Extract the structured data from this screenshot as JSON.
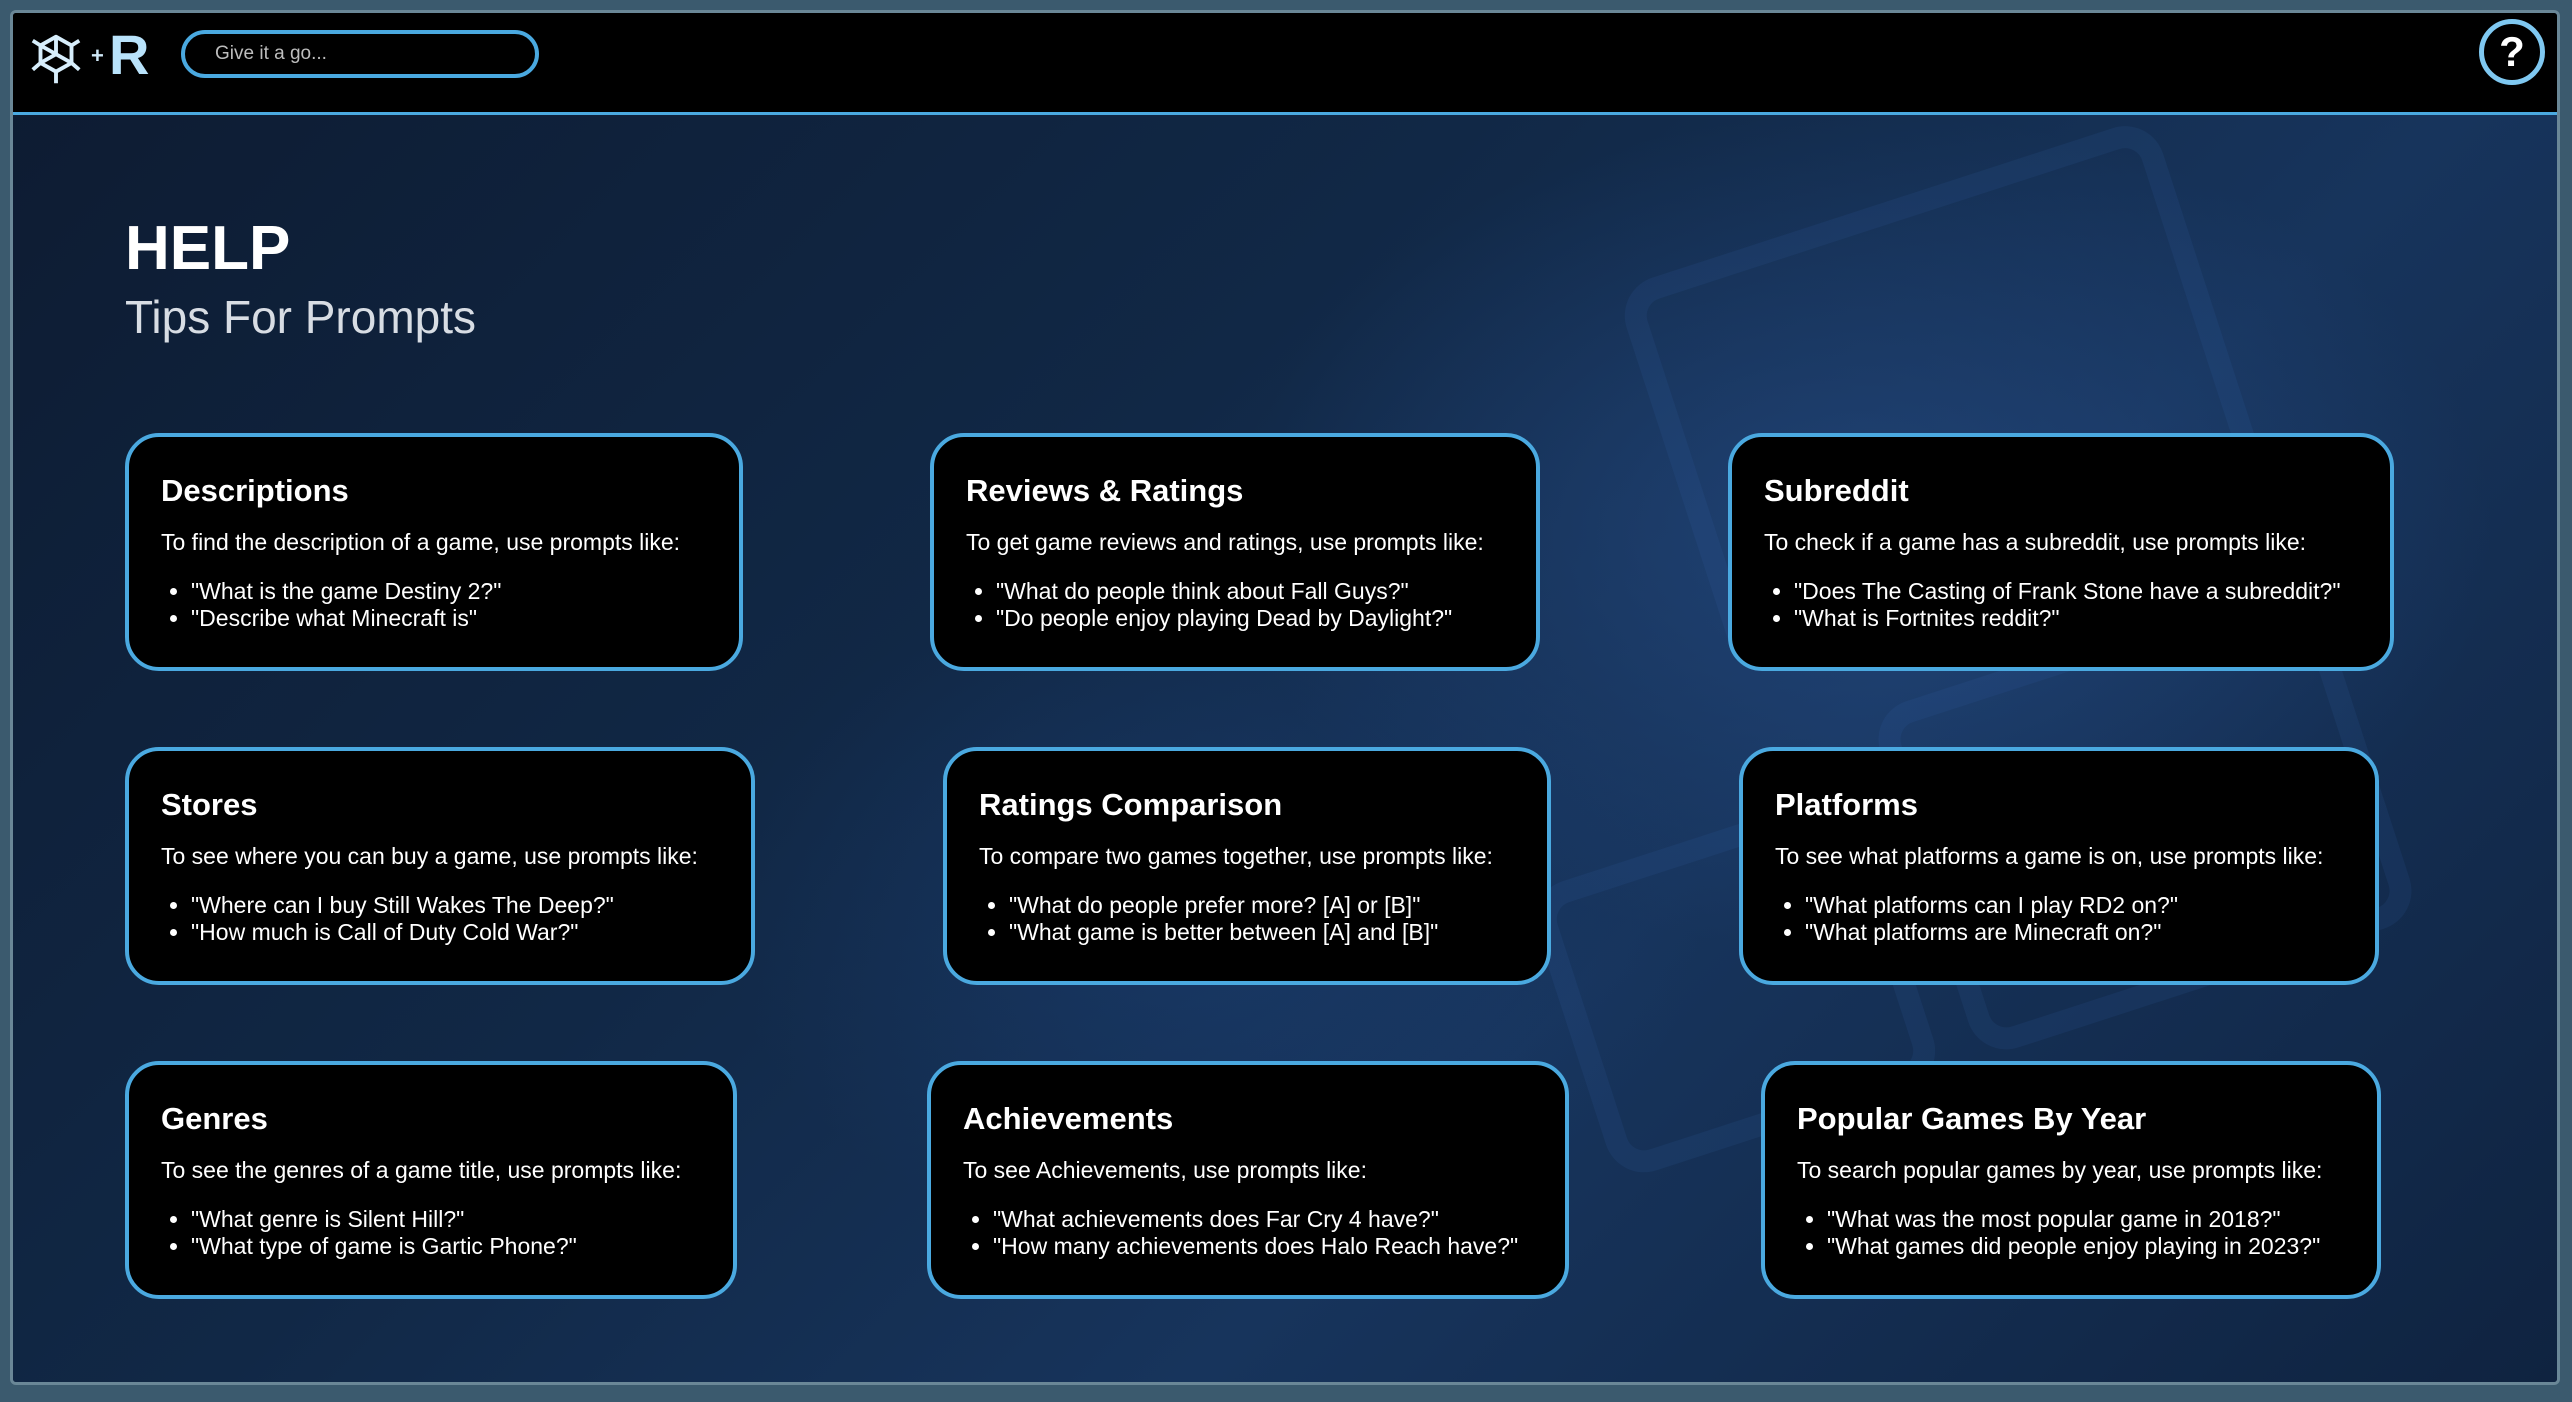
{
  "search": {
    "placeholder": "Give it a go..."
  },
  "header": {
    "help_glyph": "?",
    "plus_glyph": "+",
    "logo_letter": "R"
  },
  "icons": {
    "brand_logo": "openai-logo-icon",
    "help": "question-mark-icon"
  },
  "colors": {
    "accent": "#4aa9e0",
    "card_bg": "#000000",
    "page_bg": "#0c1d33"
  },
  "page": {
    "title": "HELP",
    "subtitle": "Tips For Prompts"
  },
  "cards": [
    {
      "title": "Descriptions",
      "intro": "To find the description of a game, use prompts like:",
      "examples": [
        "\"What is the game Destiny 2?\"",
        "\"Describe what Minecraft is\""
      ]
    },
    {
      "title": "Reviews & Ratings",
      "intro": "To get game reviews and ratings, use prompts like:",
      "examples": [
        "\"What do people think about Fall Guys?\"",
        "\"Do people enjoy playing Dead by Daylight?\""
      ]
    },
    {
      "title": "Subreddit",
      "intro": "To check if a game has a subreddit, use prompts like:",
      "examples": [
        "\"Does The Casting of Frank Stone have a subreddit?\"",
        "\"What is Fortnites reddit?\""
      ]
    },
    {
      "title": "Stores",
      "intro": "To see where you can buy a game, use prompts like:",
      "examples": [
        "\"Where can I buy Still Wakes The Deep?\"",
        "\"How much is Call of Duty Cold War?\""
      ]
    },
    {
      "title": "Ratings Comparison",
      "intro": "To compare two games together, use prompts like:",
      "examples": [
        "\"What do people prefer more? [A] or [B]\"",
        "\"What game is better between [A] and [B]\""
      ]
    },
    {
      "title": "Platforms",
      "intro": "To see what platforms a game is on, use prompts like:",
      "examples": [
        "\"What platforms can I play RD2 on?\"",
        "\"What platforms are Minecraft on?\""
      ]
    },
    {
      "title": "Genres",
      "intro": "To see the genres of a game title, use prompts like:",
      "examples": [
        "\"What genre is Silent Hill?\"",
        "\"What type of game is Gartic Phone?\""
      ]
    },
    {
      "title": "Achievements",
      "intro": "To see Achievements, use prompts like:",
      "examples": [
        "\"What achievements does Far Cry 4 have?\"",
        "\"How many achievements does Halo Reach have?\""
      ]
    },
    {
      "title": "Popular Games By Year",
      "intro": "To search popular games by year, use prompts like:",
      "examples": [
        "\"What was the most popular game in 2018?\"",
        "\"What games did people enjoy playing in 2023?\""
      ]
    }
  ]
}
